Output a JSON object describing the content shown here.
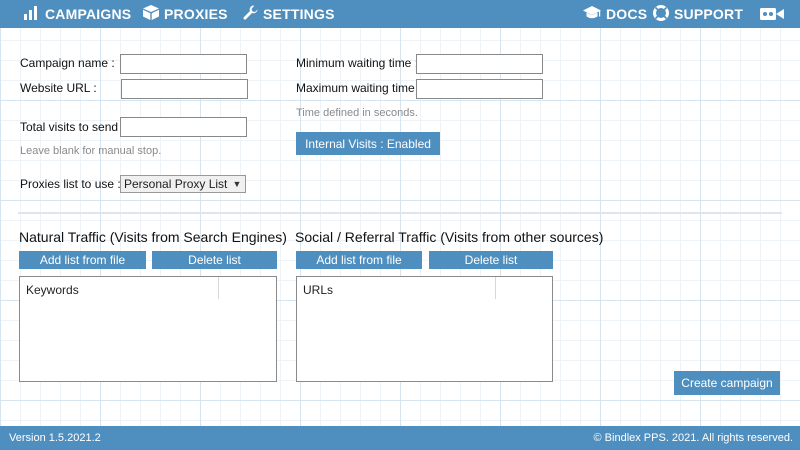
{
  "nav": {
    "campaigns": "CAMPAIGNS",
    "proxies": "PROXIES",
    "settings": "SETTINGS",
    "docs": "DOCS",
    "support": "SUPPORT"
  },
  "form": {
    "campaign_name_label": "Campaign name :",
    "campaign_name_value": "",
    "website_url_label": "Website URL :",
    "website_url_value": "",
    "total_visits_label": "Total visits to send :",
    "total_visits_value": "",
    "total_visits_hint": "Leave blank for manual stop.",
    "proxies_list_label": "Proxies list to use :",
    "proxies_list_selected": "Personal Proxy List",
    "min_wait_label": "Minimum waiting time :",
    "min_wait_value": "",
    "max_wait_label": "Maximum waiting time :",
    "max_wait_value": "",
    "time_hint": "Time defined in seconds.",
    "internal_visits_button": "Internal Visits : Enabled"
  },
  "natural": {
    "title": "Natural Traffic (Visits from Search Engines)",
    "add_button": "Add list from file",
    "delete_button": "Delete list",
    "column": "Keywords"
  },
  "social": {
    "title": "Social / Referral Traffic (Visits from other sources)",
    "add_button": "Add list from file",
    "delete_button": "Delete list",
    "column": "URLs"
  },
  "create_button": "Create campaign",
  "footer": {
    "version": "Version 1.5.2021.2",
    "copyright": "© Bindlex PPS. 2021. All rights reserved."
  },
  "colors": {
    "accent": "#4f8fbf",
    "hint": "#8a8a8a"
  },
  "icons": [
    "bar-chart-icon",
    "cube-icon",
    "wrench-icon",
    "graduation-cap-icon",
    "lifebuoy-icon",
    "video-camera-icon",
    "chevron-down-icon"
  ]
}
